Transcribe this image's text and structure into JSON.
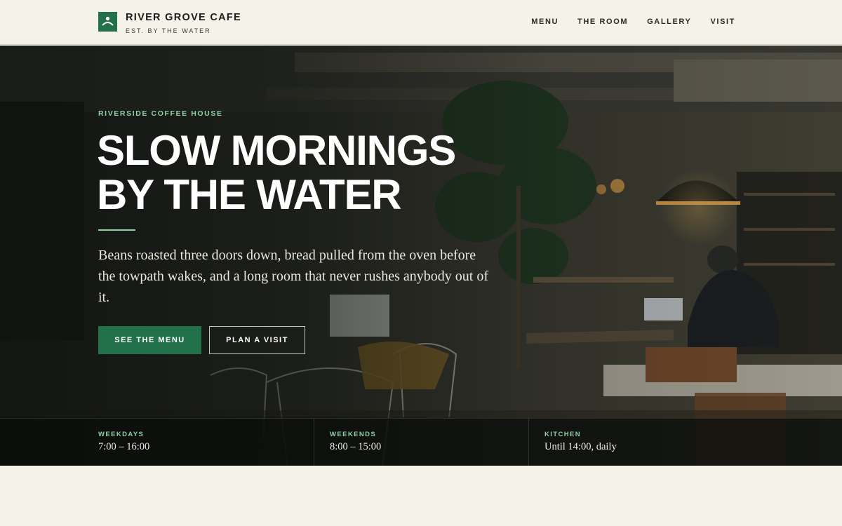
{
  "brand": {
    "name": "RIVER GROVE CAFE",
    "tagline": "EST. BY THE WATER",
    "accent_color": "#23714a",
    "logo_icon": "person-arch-icon"
  },
  "nav": {
    "items": [
      {
        "label": "MENU"
      },
      {
        "label": "THE ROOM"
      },
      {
        "label": "GALLERY"
      },
      {
        "label": "VISIT"
      }
    ]
  },
  "hero": {
    "eyebrow": "RIVERSIDE COFFEE HOUSE",
    "headline_line1": "SLOW MORNINGS",
    "headline_line2": "BY THE WATER",
    "lede": "Beans roasted three doors down, bread pulled from the oven before the towpath wakes, and a long room that never rushes anybody out of it.",
    "primary_button": "SEE THE MENU",
    "secondary_button": "PLAN A VISIT",
    "highlight_color": "#8fd0a6"
  },
  "hours": [
    {
      "label": "WEEKDAYS",
      "value": "7:00 – 16:00"
    },
    {
      "label": "WEEKENDS",
      "value": "8:00 – 15:00"
    },
    {
      "label": "KITCHEN",
      "value": "Until 14:00, daily"
    }
  ]
}
